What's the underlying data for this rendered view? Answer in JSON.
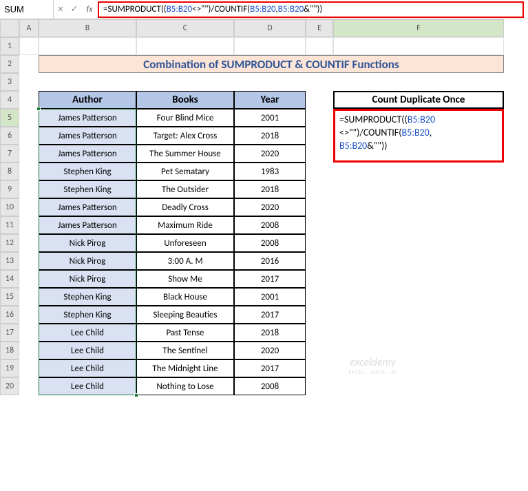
{
  "namebox": "SUM",
  "formula_bar": {
    "parts": [
      {
        "t": "=SUMPRODUCT((",
        "c": "fb-black"
      },
      {
        "t": "B5:B20",
        "c": "fb-ref"
      },
      {
        "t": "<>\"\")/COUNTIF(",
        "c": "fb-black"
      },
      {
        "t": "B5:B20",
        "c": "fb-ref"
      },
      {
        "t": ",",
        "c": "fb-black"
      },
      {
        "t": "B5:B20",
        "c": "fb-ref"
      },
      {
        "t": "&\"\"))",
        "c": "fb-black"
      }
    ]
  },
  "columns": [
    "A",
    "B",
    "C",
    "D",
    "E",
    "F"
  ],
  "rows": [
    "1",
    "2",
    "3",
    "4",
    "5",
    "6",
    "7",
    "8",
    "9",
    "10",
    "11",
    "12",
    "13",
    "14",
    "15",
    "16",
    "17",
    "18",
    "19",
    "20"
  ],
  "title": "Combination of SUMPRODUCT & COUNTIF Functions",
  "table": {
    "headers": {
      "author": "Author",
      "books": "Books",
      "year": "Year"
    },
    "rows": [
      {
        "author": "James Patterson",
        "book": "Four Blind Mice",
        "year": "2001"
      },
      {
        "author": "James Patterson",
        "book": "Target: Alex Cross",
        "year": "2018"
      },
      {
        "author": "James Patterson",
        "book": "The Summer House",
        "year": "2020"
      },
      {
        "author": "Stephen King",
        "book": "Pet Sematary",
        "year": "1983"
      },
      {
        "author": "Stephen King",
        "book": "The Outsider",
        "year": "2018"
      },
      {
        "author": "James Patterson",
        "book": "Deadly Cross",
        "year": "2020"
      },
      {
        "author": "James Patterson",
        "book": "Maximum Ride",
        "year": "2008"
      },
      {
        "author": "Nick Pirog",
        "book": "Unforeseen",
        "year": "2008"
      },
      {
        "author": "Nick Pirog",
        "book": "3:00 A. M",
        "year": "2016"
      },
      {
        "author": "Nick Pirog",
        "book": "Show Me",
        "year": "2017"
      },
      {
        "author": "Stephen King",
        "book": "Black House",
        "year": "2001"
      },
      {
        "author": "Stephen King",
        "book": "Sleeping Beauties",
        "year": "2017"
      },
      {
        "author": "Lee Child",
        "book": "Past Tense",
        "year": "2018"
      },
      {
        "author": "Lee Child",
        "book": "The Sentinel",
        "year": "2020"
      },
      {
        "author": "Lee Child",
        "book": "The Midnight Line",
        "year": "2017"
      },
      {
        "author": "Lee Child",
        "book": "Nothing to Lose",
        "year": "2008"
      }
    ]
  },
  "count_header": "Count Duplicate Once",
  "formula_cell": {
    "parts": [
      {
        "t": "=SUMPRODUCT((",
        "c": "fc-black"
      },
      {
        "t": "B5:",
        "c": "fc-ref"
      },
      {
        "t": "B20",
        "c": "fc-ref",
        "br": true
      },
      {
        "t": "<>\"\")/COUNTIF(",
        "c": "fc-black"
      },
      {
        "t": "B5:B20",
        "c": "fc-ref"
      },
      {
        "t": ",",
        "c": "fc-black",
        "br": true
      },
      {
        "t": "B5:B20",
        "c": "fc-ref"
      },
      {
        "t": "&\"\"))",
        "c": "fc-black"
      }
    ]
  },
  "watermark": {
    "line1": "exceldemy",
    "line2": "EXCEL · DATA · BI"
  }
}
